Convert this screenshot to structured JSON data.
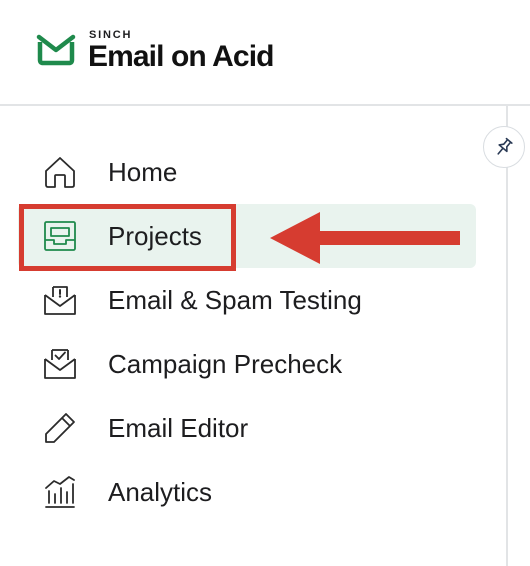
{
  "brand": {
    "sinch": "SINCH",
    "name": "Email on Acid",
    "color": "#1f8a4c"
  },
  "sidebar": {
    "items": [
      {
        "label": "Home",
        "icon": "home-icon",
        "active": false
      },
      {
        "label": "Projects",
        "icon": "projects-icon",
        "active": true
      },
      {
        "label": "Email & Spam Testing",
        "icon": "email-alert-icon",
        "active": false
      },
      {
        "label": "Campaign Precheck",
        "icon": "email-check-icon",
        "active": false
      },
      {
        "label": "Email Editor",
        "icon": "pencil-icon",
        "active": false
      },
      {
        "label": "Analytics",
        "icon": "analytics-icon",
        "active": false
      }
    ],
    "pin_icon": "pin-icon"
  },
  "annotation": {
    "highlight_color": "#d63c30",
    "arrow_icon": "arrow-left-icon"
  }
}
